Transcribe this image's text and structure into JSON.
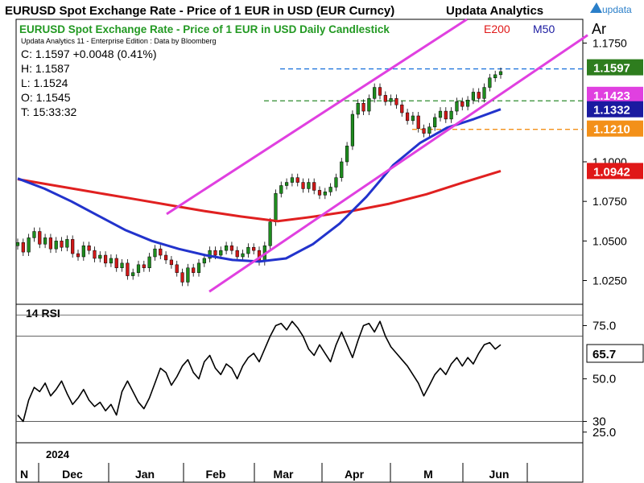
{
  "header": {
    "title": "EURUSD Spot Exchange Rate - Price of 1 EUR in USD (EUR Curncy)",
    "brand": "Updata Analytics",
    "logo_text": "updata",
    "logo_color": "#2a7fc9"
  },
  "main_panel": {
    "chart_title": "EURUSD Spot Exchange Rate - Price of 1 EUR in USD Daily Candlestick",
    "ma200_label": "E200",
    "ma50_label": "M50",
    "subtitle": "Updata Analytics 11 - Enterprise Edition : Data by Bloomberg",
    "stats": {
      "close": "C: 1.1597  +0.0048 (0.41%)",
      "high": "H: 1.1587",
      "low": "L: 1.1524",
      "open": "O: 1.1545",
      "time": "T: 15:33:32"
    },
    "corner_label": "Ar",
    "price_tags": [
      {
        "text": "1.1597",
        "value": 1.1597,
        "color": "#2e7d1e"
      },
      {
        "text": "1.1423",
        "value": 1.1423,
        "color": "#e040e0"
      },
      {
        "text": "1.1332",
        "value": 1.1332,
        "color": "#1a1aa0"
      },
      {
        "text": "1.1210",
        "value": 1.121,
        "color": "#f39019"
      },
      {
        "text": "1.0942",
        "value": 1.0942,
        "color": "#e01818"
      }
    ]
  },
  "rsi_panel": {
    "label": "14 RSI",
    "value_tag": "65.7"
  },
  "x_axis": {
    "year_label": "2024",
    "months": [
      "N",
      "Dec",
      "Jan",
      "Feb",
      "Mar",
      "Apr",
      "M",
      "Jun"
    ]
  },
  "colors": {
    "up_candle": "#1e8c1e",
    "down_candle": "#d01818",
    "ma200": "#e02020",
    "ma50": "#2233cc",
    "channel": "#e040e0",
    "rsi": "#000000"
  },
  "chart_data": [
    {
      "type": "candlestick",
      "title": "EURUSD Spot Exchange Rate - Price of 1 EUR in USD Daily Candlestick",
      "xlabel": "",
      "ylabel": "",
      "x_tick_labels": [
        "N",
        "Dec",
        "Jan",
        "Feb",
        "Mar",
        "Apr",
        "M",
        "Jun"
      ],
      "ylim": [
        1.01,
        1.19
      ],
      "y_ticks": [
        1.025,
        1.05,
        1.075,
        1.1,
        1.175
      ],
      "y_tick_labels": [
        "1.0250",
        "1.0500",
        "1.0750",
        "1.1000",
        "1.1750"
      ],
      "grid": false,
      "legend": "top-right",
      "series": [
        {
          "name": "Close",
          "values": [
            1.049,
            1.043,
            1.052,
            1.056,
            1.048,
            1.052,
            1.045,
            1.05,
            1.046,
            1.051,
            1.042,
            1.04,
            1.047,
            1.044,
            1.039,
            1.041,
            1.036,
            1.039,
            1.033,
            1.036,
            1.028,
            1.03,
            1.035,
            1.033,
            1.04,
            1.045,
            1.041,
            1.038,
            1.035,
            1.03,
            1.024,
            1.033,
            1.03,
            1.036,
            1.039,
            1.044,
            1.041,
            1.044,
            1.047,
            1.044,
            1.04,
            1.042,
            1.046,
            1.044,
            1.037,
            1.047,
            1.062,
            1.08,
            1.085,
            1.087,
            1.09,
            1.087,
            1.083,
            1.087,
            1.082,
            1.079,
            1.081,
            1.084,
            1.09,
            1.1,
            1.11,
            1.13,
            1.137,
            1.132,
            1.14,
            1.147,
            1.142,
            1.138,
            1.14,
            1.136,
            1.131,
            1.126,
            1.129,
            1.121,
            1.118,
            1.122,
            1.128,
            1.132,
            1.127,
            1.132,
            1.138,
            1.135,
            1.139,
            1.144,
            1.14,
            1.147,
            1.153,
            1.155,
            1.157
          ]
        },
        {
          "name": "E200",
          "values": [
            1.089,
            1.085,
            1.081,
            1.077,
            1.073,
            1.069,
            1.0655,
            1.0625,
            1.0655,
            1.069,
            1.0735,
            1.0795,
            1.087,
            1.0942
          ]
        },
        {
          "name": "M50",
          "values": [
            1.0895,
            1.083,
            1.075,
            1.066,
            1.057,
            1.05,
            1.045,
            1.041,
            1.038,
            1.037,
            1.039,
            1.048,
            1.061,
            1.078,
            1.098,
            1.112,
            1.1215,
            1.127,
            1.1332
          ]
        },
        {
          "name": "Upper channel",
          "values": [
            1.067,
            1.19
          ]
        },
        {
          "name": "Lower channel",
          "values": [
            1.018,
            1.18
          ]
        }
      ],
      "reference_lines": [
        1.1587,
        1.1385,
        1.1205
      ]
    },
    {
      "type": "line",
      "title": "14 RSI",
      "ylim": [
        20,
        85
      ],
      "y_ticks": [
        25,
        30,
        50,
        75
      ],
      "y_tick_labels": [
        "25.0",
        "30",
        "50.0",
        "75.0"
      ],
      "reference_lines": [
        30,
        70,
        80
      ],
      "series": [
        {
          "name": "14 RSI",
          "values": [
            33,
            30,
            40,
            46,
            44,
            48,
            42,
            45,
            49,
            43,
            38,
            41,
            45,
            40,
            37,
            39,
            35,
            38,
            33,
            44,
            49,
            44,
            39,
            36,
            41,
            48,
            55,
            53,
            47,
            51,
            56,
            59,
            53,
            50,
            58,
            61,
            55,
            52,
            57,
            55,
            50,
            56,
            60,
            62,
            58,
            64,
            70,
            75,
            76,
            73,
            77,
            74,
            70,
            64,
            61,
            66,
            62,
            58,
            66,
            72,
            66,
            60,
            68,
            75,
            76,
            72,
            77,
            70,
            65,
            62,
            59,
            56,
            52,
            48,
            42,
            47,
            52,
            55,
            52,
            57,
            60,
            56,
            60,
            57,
            62,
            66,
            67,
            64,
            66
          ]
        }
      ]
    }
  ]
}
